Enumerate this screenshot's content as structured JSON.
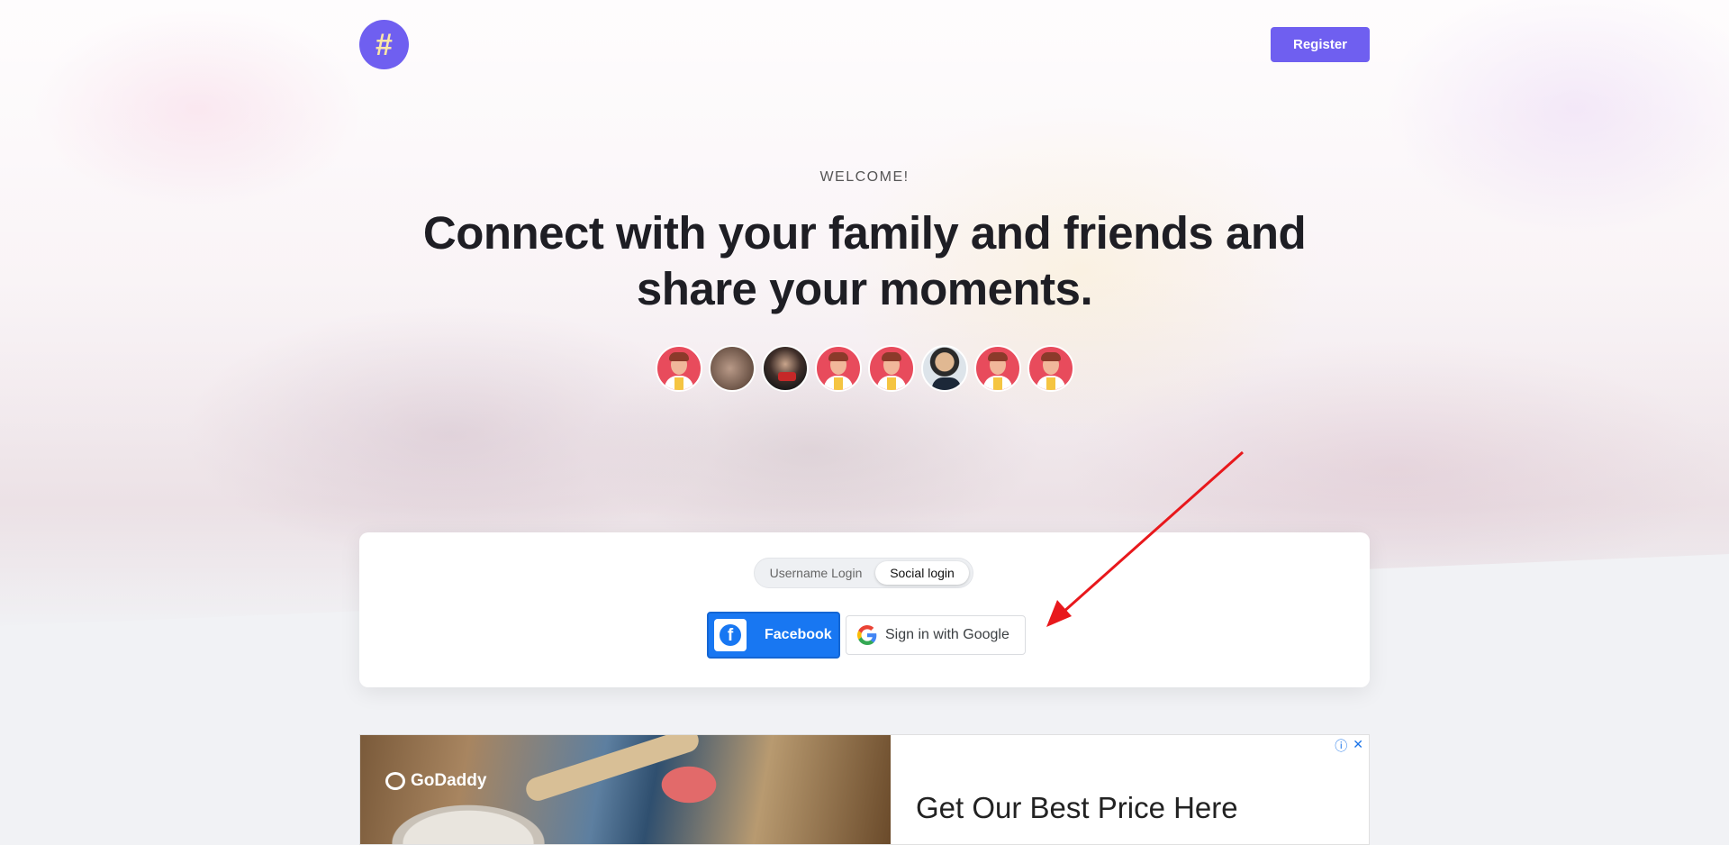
{
  "header": {
    "logo_icon": "hashtag-icon",
    "logo_glyph": "#",
    "register_label": "Register",
    "brand_color": "#6f5ff0"
  },
  "hero": {
    "welcome": "WELCOME!",
    "headline": "Connect with your family and friends and share your moments.",
    "avatars": [
      {
        "kind": "default"
      },
      {
        "kind": "photo"
      },
      {
        "kind": "photo"
      },
      {
        "kind": "default"
      },
      {
        "kind": "default"
      },
      {
        "kind": "photo"
      },
      {
        "kind": "default"
      },
      {
        "kind": "default"
      }
    ]
  },
  "login": {
    "tabs": [
      {
        "label": "Username Login",
        "active": false
      },
      {
        "label": "Social login",
        "active": true
      }
    ],
    "facebook_label": "Facebook",
    "facebook_icon": "facebook-icon",
    "facebook_color": "#1877f2",
    "google_label": "Sign in with Google",
    "google_icon": "google-g-icon"
  },
  "annotation": {
    "arrow_color": "#e8181c"
  },
  "ad": {
    "brand": "GoDaddy",
    "headline": "Get Our Best Price Here",
    "info_icon": "ⓘ",
    "close_icon": "✕"
  }
}
